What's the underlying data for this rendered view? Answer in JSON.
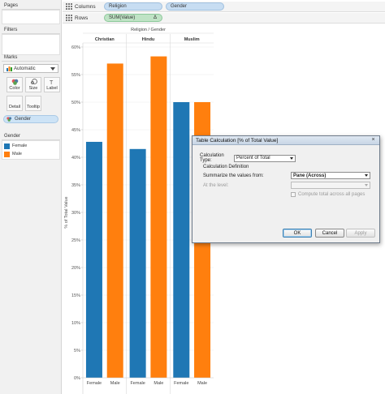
{
  "left_panel": {
    "pages_title": "Pages",
    "filters_title": "Filters",
    "marks_title": "Marks",
    "marks_type": "Automatic",
    "mark_buttons": {
      "color": "Color",
      "size": "Size",
      "label": "Label",
      "detail": "Detail",
      "tooltip": "Tooltip"
    },
    "color_field": "Gender",
    "legend_title": "Gender",
    "legend": [
      {
        "label": "Female",
        "color": "#1f77b4"
      },
      {
        "label": "Male",
        "color": "#ff7f0e"
      }
    ]
  },
  "shelves": {
    "columns_label": "Columns",
    "columns_pills": [
      "Religion",
      "Gender"
    ],
    "rows_label": "Rows",
    "rows_pill": "SUM(Value)",
    "rows_pill_icon": "Δ"
  },
  "chart_data": {
    "type": "bar",
    "header": "Religion / Gender",
    "panes": [
      "Christian",
      "Hindu",
      "Muslim"
    ],
    "categories": [
      "Female",
      "Male"
    ],
    "series": [
      {
        "name": "Female",
        "color": "#1f77b4",
        "values": [
          42.8,
          41.5,
          50.0
        ]
      },
      {
        "name": "Male",
        "color": "#ff7f0e",
        "values": [
          57.0,
          58.3,
          50.0
        ]
      }
    ],
    "ylabel": "% of Total Value",
    "ylim": [
      0,
      60
    ],
    "yticks": [
      "0%",
      "5%",
      "10%",
      "15%",
      "20%",
      "25%",
      "30%",
      "35%",
      "40%",
      "45%",
      "50%",
      "55%",
      "60%"
    ]
  },
  "dialog": {
    "title": "Table Calculation [% of Total Value]",
    "close_icon": "×",
    "calc_type_label": "Calculation Type:",
    "calc_type_value": "Percent of Total",
    "definition_label": "Calculation Definition",
    "summarize_label": "Summarize the values from:",
    "summarize_value": "Pane (Across)",
    "level_label": "At the level:",
    "level_value": "",
    "compute_label": "Compute total across all pages",
    "ok": "OK",
    "cancel": "Cancel",
    "apply": "Apply"
  }
}
